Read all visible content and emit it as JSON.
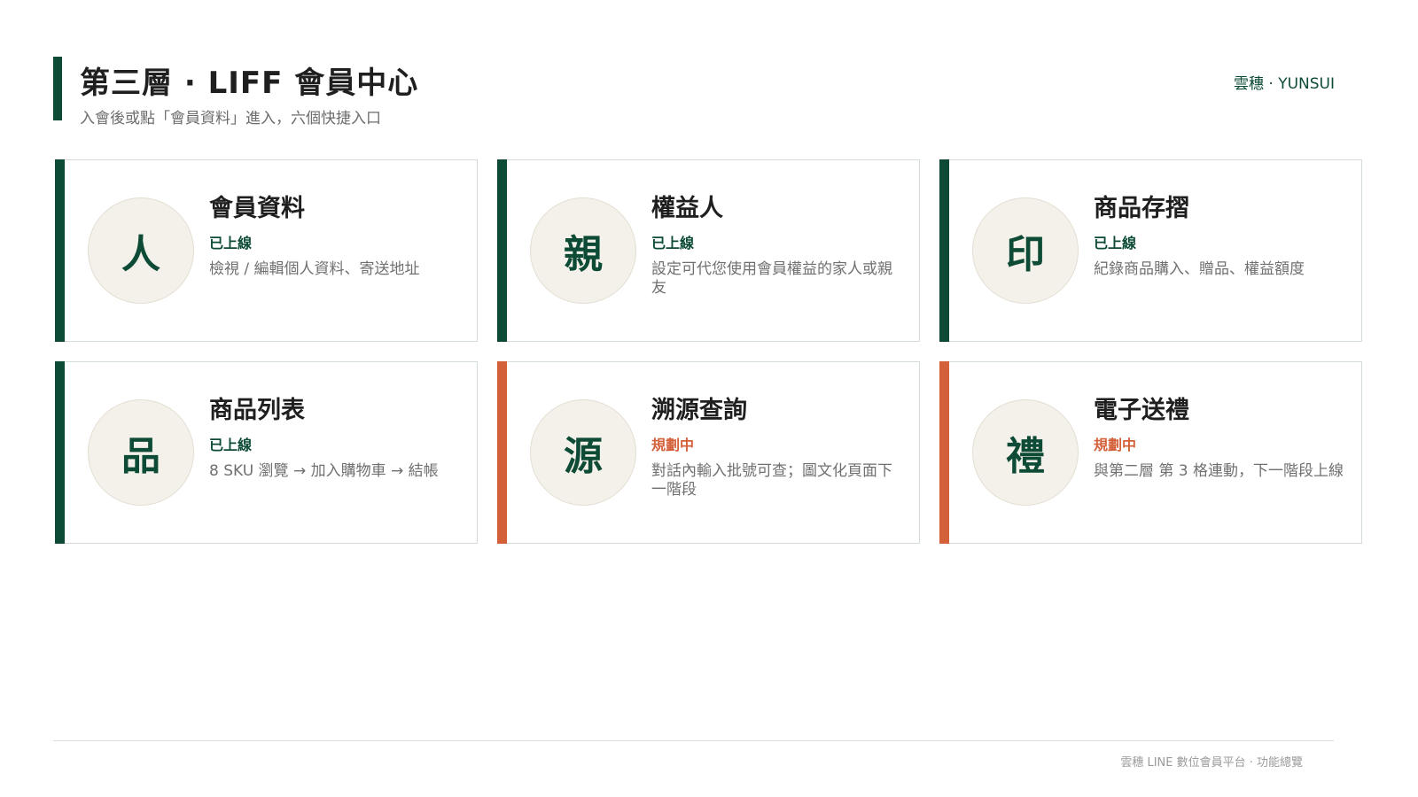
{
  "header": {
    "title": "第三層 · LIFF 會員中心",
    "subtitle": "入會後或點「會員資料」進入，六個快捷入口",
    "brand": "雲穗 · YUNSUI"
  },
  "colors": {
    "accent_green": "#0d4b36",
    "accent_orange": "#d4603a",
    "status_live": "#0d4b36",
    "status_planned": "#d4603a",
    "glyph_bg": "#f3f1ea"
  },
  "cards": [
    {
      "glyph": "人",
      "title": "會員資料",
      "status": "已上線",
      "status_kind": "live",
      "desc": "檢視 / 編輯個人資料、寄送地址"
    },
    {
      "glyph": "親",
      "title": "權益人",
      "status": "已上線",
      "status_kind": "live",
      "desc": "設定可代您使用會員權益的家人或親友"
    },
    {
      "glyph": "印",
      "title": "商品存摺",
      "status": "已上線",
      "status_kind": "live",
      "desc": "紀錄商品購入、贈品、權益額度"
    },
    {
      "glyph": "品",
      "title": "商品列表",
      "status": "已上線",
      "status_kind": "live",
      "desc": "8 SKU 瀏覽 → 加入購物車 → 結帳"
    },
    {
      "glyph": "源",
      "title": "溯源查詢",
      "status": "規劃中",
      "status_kind": "planned",
      "desc": "對話內輸入批號可查；圖文化頁面下一階段"
    },
    {
      "glyph": "禮",
      "title": "電子送禮",
      "status": "規劃中",
      "status_kind": "planned",
      "desc": "與第二層 第 3 格連動，下一階段上線"
    }
  ],
  "footer": {
    "text": "雲穗 LINE 數位會員平台 · 功能總覽"
  }
}
